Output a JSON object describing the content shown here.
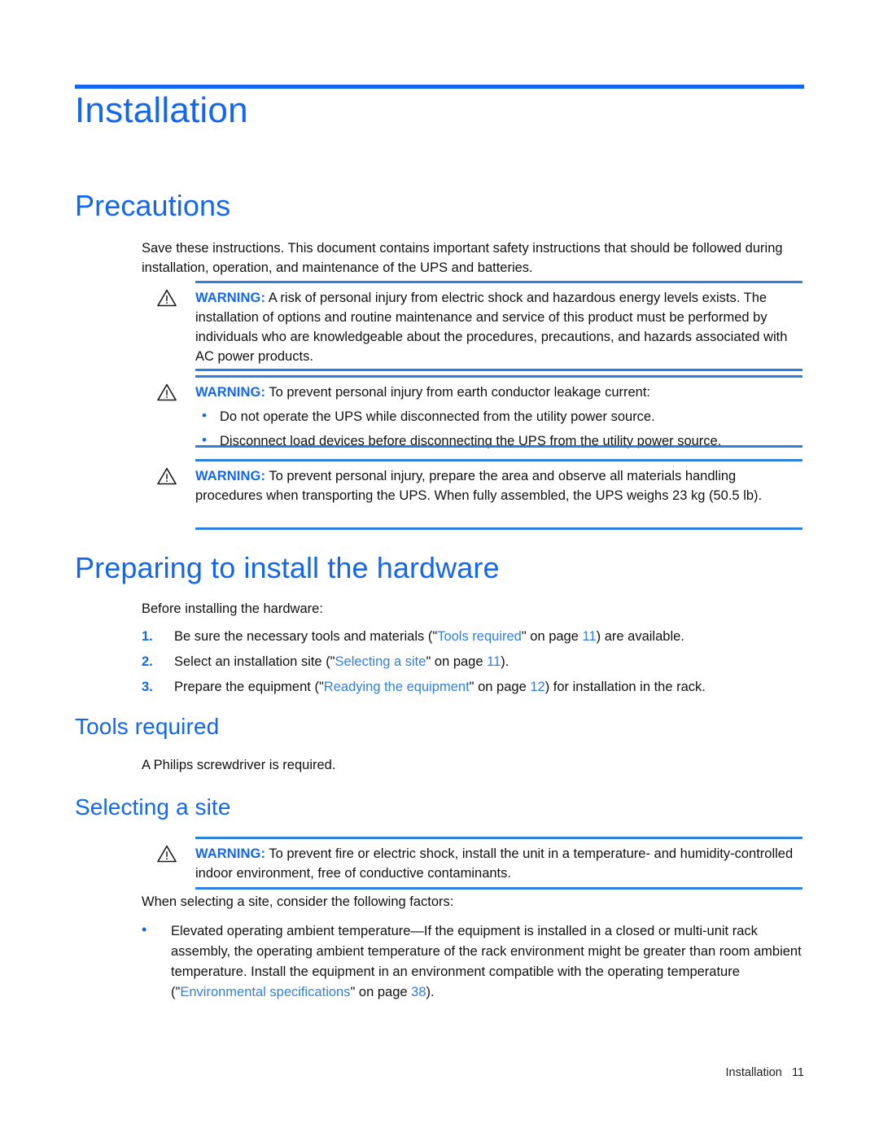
{
  "document": {
    "chapter_title": "Installation",
    "footer_section": "Installation",
    "footer_page": "11",
    "accent_blue": "#1266f1",
    "rule_blue": "#2f7fe0",
    "warning_icon": "warning-triangle-icon"
  },
  "precautions": {
    "heading": "Precautions",
    "intro": "Save these instructions. This document contains important safety instructions that should be followed during installation, operation, and maintenance of the UPS and batteries.",
    "warnings": [
      {
        "label": "WARNING:",
        "text": "A risk of personal injury from electric shock and hazardous energy levels exists. The installation of options and routine maintenance and service of this product must be performed by individuals who are knowledgeable about the procedures, precautions, and hazards associated with AC power products."
      },
      {
        "label": "WARNING:",
        "text": "To prevent personal injury from earth conductor leakage current:",
        "bullets": [
          "Do not operate the UPS while disconnected from the utility power source.",
          "Disconnect load devices before disconnecting the UPS from the utility power source."
        ]
      },
      {
        "label": "WARNING:",
        "text": "To prevent personal injury, prepare the area and observe all materials handling procedures when transporting the UPS. When fully assembled, the UPS weighs 23 kg (50.5 lb)."
      }
    ]
  },
  "preparing": {
    "heading": "Preparing to install the hardware",
    "intro": "Before installing the hardware:",
    "steps": [
      {
        "num": "1.",
        "pre": "Be sure the necessary tools and materials (\"",
        "xref": "Tools required",
        "mid": "\" on page ",
        "page": "11",
        "post": ") are available."
      },
      {
        "num": "2.",
        "pre": "Select an installation site (\"",
        "xref": "Selecting a site",
        "mid": "\" on page ",
        "page": "11",
        "post": ")."
      },
      {
        "num": "3.",
        "pre": "Prepare the equipment (\"",
        "xref": "Readying the equipment",
        "mid": "\" on page ",
        "page": "12",
        "post": ") for installation in the rack."
      }
    ]
  },
  "tools_required": {
    "heading": "Tools required",
    "text": "A Philips screwdriver is required."
  },
  "selecting_site": {
    "heading": "Selecting a site",
    "warning": {
      "label": "WARNING:",
      "text": "To prevent fire or electric shock, install the unit in a temperature- and humidity-controlled indoor environment, free of conductive contaminants."
    },
    "intro": "When selecting a site, consider the following factors:",
    "factor": {
      "pre": "Elevated operating ambient temperature—If the equipment is installed in a closed or multi-unit rack assembly, the operating ambient temperature of the rack environment might be greater than room ambient temperature. Install the equipment in an environment compatible with the operating temperature (\"",
      "xref": "Environmental specifications",
      "mid": "\" on page ",
      "page": "38",
      "post": ")."
    }
  }
}
